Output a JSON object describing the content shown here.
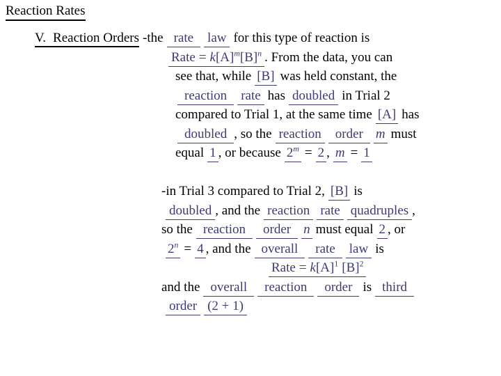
{
  "slide": {
    "title": "Reaction Rates",
    "section": {
      "number": "V.",
      "heading": "Reaction Orders"
    }
  },
  "paragraph1": {
    "s1": "-the",
    "a1": "rate",
    "a2": "law",
    "s2": "for this type of reaction is",
    "eq1": {
      "rate_word": "Rate",
      "equals": "=",
      "k": "k",
      "a_bracket": "[A]",
      "exp_m": "m",
      "b_bracket": "[B]",
      "exp_n": "n"
    },
    "s3": ".  From the data, you can",
    "s4": "see that, while",
    "a3": "[B]",
    "s5": "was held constant, the",
    "a4": "reaction",
    "a5": "rate",
    "s6": "has",
    "a6": "doubled",
    "s7": "in Trial 2",
    "s8": "compared to Trial 1, at the same time",
    "a7": "[A]",
    "s9": "has",
    "a8": "doubled",
    "s10": ", so the",
    "a9": "reaction",
    "a10": "order",
    "a11": "m",
    "s11": "must",
    "s12": "equal",
    "a12": "1",
    "s13": ", or because",
    "a13": "2",
    "a13_exp": "m",
    "s14": "=",
    "a14": "2",
    "s15": ",",
    "a15": "m",
    "s16": "=",
    "a16": "1"
  },
  "paragraph2": {
    "s1": "-in Trial 3 compared to Trial 2,",
    "a1": "[B]",
    "s2": "is",
    "a2": "doubled",
    "s3": ", and the",
    "a3": "reaction",
    "a4": "rate",
    "a5": "quadruples",
    "s4": ",",
    "s5": "so the",
    "a6": "reaction",
    "a7": "order",
    "a8": "n",
    "s6": "must equal",
    "a9": "2",
    "s7": ", or",
    "a10": "2",
    "a10_exp": "n",
    "s8": "=",
    "a11": "4",
    "s9": ", and the",
    "a12": "overall",
    "a13": "rate",
    "a14": "law",
    "s10": "is",
    "eq2": {
      "rate_word": "Rate",
      "equals": "=",
      "k": "k",
      "a_bracket": "[A]",
      "exp_1": "1",
      "b_bracket": "[B]",
      "exp_2": "2"
    },
    "s11": "and the",
    "a15": "overall",
    "a16": "reaction",
    "a17": "order",
    "s12": "is",
    "a18": "third",
    "a19": "order",
    "a20": "(2 + 1)"
  },
  "colors": {
    "answer_blue": "#3b3b78",
    "static_black": "#000000",
    "background": "#ffffff"
  }
}
